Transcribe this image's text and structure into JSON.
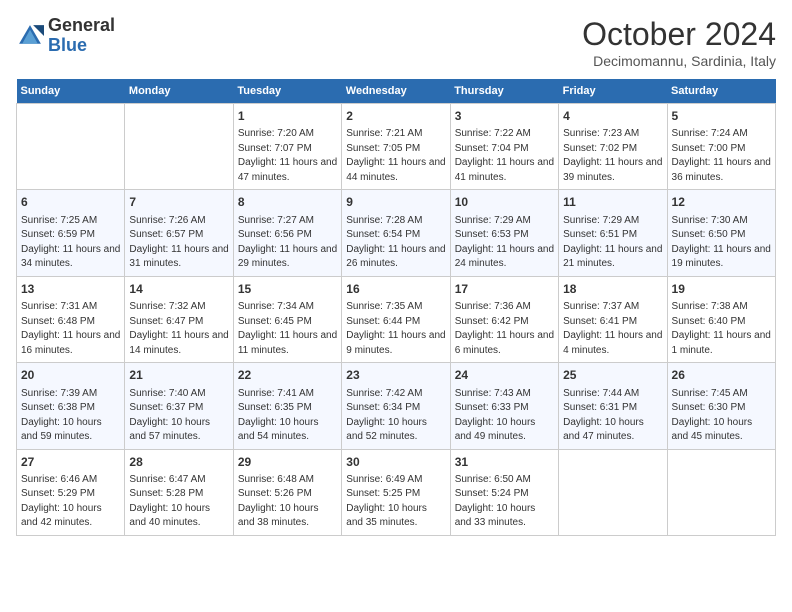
{
  "header": {
    "logo_line1": "General",
    "logo_line2": "Blue",
    "month_title": "October 2024",
    "subtitle": "Decimomannu, Sardinia, Italy"
  },
  "days_of_week": [
    "Sunday",
    "Monday",
    "Tuesday",
    "Wednesday",
    "Thursday",
    "Friday",
    "Saturday"
  ],
  "weeks": [
    [
      {
        "num": "",
        "sunrise": "",
        "sunset": "",
        "daylight": ""
      },
      {
        "num": "",
        "sunrise": "",
        "sunset": "",
        "daylight": ""
      },
      {
        "num": "1",
        "sunrise": "Sunrise: 7:20 AM",
        "sunset": "Sunset: 7:07 PM",
        "daylight": "Daylight: 11 hours and 47 minutes."
      },
      {
        "num": "2",
        "sunrise": "Sunrise: 7:21 AM",
        "sunset": "Sunset: 7:05 PM",
        "daylight": "Daylight: 11 hours and 44 minutes."
      },
      {
        "num": "3",
        "sunrise": "Sunrise: 7:22 AM",
        "sunset": "Sunset: 7:04 PM",
        "daylight": "Daylight: 11 hours and 41 minutes."
      },
      {
        "num": "4",
        "sunrise": "Sunrise: 7:23 AM",
        "sunset": "Sunset: 7:02 PM",
        "daylight": "Daylight: 11 hours and 39 minutes."
      },
      {
        "num": "5",
        "sunrise": "Sunrise: 7:24 AM",
        "sunset": "Sunset: 7:00 PM",
        "daylight": "Daylight: 11 hours and 36 minutes."
      }
    ],
    [
      {
        "num": "6",
        "sunrise": "Sunrise: 7:25 AM",
        "sunset": "Sunset: 6:59 PM",
        "daylight": "Daylight: 11 hours and 34 minutes."
      },
      {
        "num": "7",
        "sunrise": "Sunrise: 7:26 AM",
        "sunset": "Sunset: 6:57 PM",
        "daylight": "Daylight: 11 hours and 31 minutes."
      },
      {
        "num": "8",
        "sunrise": "Sunrise: 7:27 AM",
        "sunset": "Sunset: 6:56 PM",
        "daylight": "Daylight: 11 hours and 29 minutes."
      },
      {
        "num": "9",
        "sunrise": "Sunrise: 7:28 AM",
        "sunset": "Sunset: 6:54 PM",
        "daylight": "Daylight: 11 hours and 26 minutes."
      },
      {
        "num": "10",
        "sunrise": "Sunrise: 7:29 AM",
        "sunset": "Sunset: 6:53 PM",
        "daylight": "Daylight: 11 hours and 24 minutes."
      },
      {
        "num": "11",
        "sunrise": "Sunrise: 7:29 AM",
        "sunset": "Sunset: 6:51 PM",
        "daylight": "Daylight: 11 hours and 21 minutes."
      },
      {
        "num": "12",
        "sunrise": "Sunrise: 7:30 AM",
        "sunset": "Sunset: 6:50 PM",
        "daylight": "Daylight: 11 hours and 19 minutes."
      }
    ],
    [
      {
        "num": "13",
        "sunrise": "Sunrise: 7:31 AM",
        "sunset": "Sunset: 6:48 PM",
        "daylight": "Daylight: 11 hours and 16 minutes."
      },
      {
        "num": "14",
        "sunrise": "Sunrise: 7:32 AM",
        "sunset": "Sunset: 6:47 PM",
        "daylight": "Daylight: 11 hours and 14 minutes."
      },
      {
        "num": "15",
        "sunrise": "Sunrise: 7:34 AM",
        "sunset": "Sunset: 6:45 PM",
        "daylight": "Daylight: 11 hours and 11 minutes."
      },
      {
        "num": "16",
        "sunrise": "Sunrise: 7:35 AM",
        "sunset": "Sunset: 6:44 PM",
        "daylight": "Daylight: 11 hours and 9 minutes."
      },
      {
        "num": "17",
        "sunrise": "Sunrise: 7:36 AM",
        "sunset": "Sunset: 6:42 PM",
        "daylight": "Daylight: 11 hours and 6 minutes."
      },
      {
        "num": "18",
        "sunrise": "Sunrise: 7:37 AM",
        "sunset": "Sunset: 6:41 PM",
        "daylight": "Daylight: 11 hours and 4 minutes."
      },
      {
        "num": "19",
        "sunrise": "Sunrise: 7:38 AM",
        "sunset": "Sunset: 6:40 PM",
        "daylight": "Daylight: 11 hours and 1 minute."
      }
    ],
    [
      {
        "num": "20",
        "sunrise": "Sunrise: 7:39 AM",
        "sunset": "Sunset: 6:38 PM",
        "daylight": "Daylight: 10 hours and 59 minutes."
      },
      {
        "num": "21",
        "sunrise": "Sunrise: 7:40 AM",
        "sunset": "Sunset: 6:37 PM",
        "daylight": "Daylight: 10 hours and 57 minutes."
      },
      {
        "num": "22",
        "sunrise": "Sunrise: 7:41 AM",
        "sunset": "Sunset: 6:35 PM",
        "daylight": "Daylight: 10 hours and 54 minutes."
      },
      {
        "num": "23",
        "sunrise": "Sunrise: 7:42 AM",
        "sunset": "Sunset: 6:34 PM",
        "daylight": "Daylight: 10 hours and 52 minutes."
      },
      {
        "num": "24",
        "sunrise": "Sunrise: 7:43 AM",
        "sunset": "Sunset: 6:33 PM",
        "daylight": "Daylight: 10 hours and 49 minutes."
      },
      {
        "num": "25",
        "sunrise": "Sunrise: 7:44 AM",
        "sunset": "Sunset: 6:31 PM",
        "daylight": "Daylight: 10 hours and 47 minutes."
      },
      {
        "num": "26",
        "sunrise": "Sunrise: 7:45 AM",
        "sunset": "Sunset: 6:30 PM",
        "daylight": "Daylight: 10 hours and 45 minutes."
      }
    ],
    [
      {
        "num": "27",
        "sunrise": "Sunrise: 6:46 AM",
        "sunset": "Sunset: 5:29 PM",
        "daylight": "Daylight: 10 hours and 42 minutes."
      },
      {
        "num": "28",
        "sunrise": "Sunrise: 6:47 AM",
        "sunset": "Sunset: 5:28 PM",
        "daylight": "Daylight: 10 hours and 40 minutes."
      },
      {
        "num": "29",
        "sunrise": "Sunrise: 6:48 AM",
        "sunset": "Sunset: 5:26 PM",
        "daylight": "Daylight: 10 hours and 38 minutes."
      },
      {
        "num": "30",
        "sunrise": "Sunrise: 6:49 AM",
        "sunset": "Sunset: 5:25 PM",
        "daylight": "Daylight: 10 hours and 35 minutes."
      },
      {
        "num": "31",
        "sunrise": "Sunrise: 6:50 AM",
        "sunset": "Sunset: 5:24 PM",
        "daylight": "Daylight: 10 hours and 33 minutes."
      },
      {
        "num": "",
        "sunrise": "",
        "sunset": "",
        "daylight": ""
      },
      {
        "num": "",
        "sunrise": "",
        "sunset": "",
        "daylight": ""
      }
    ]
  ]
}
